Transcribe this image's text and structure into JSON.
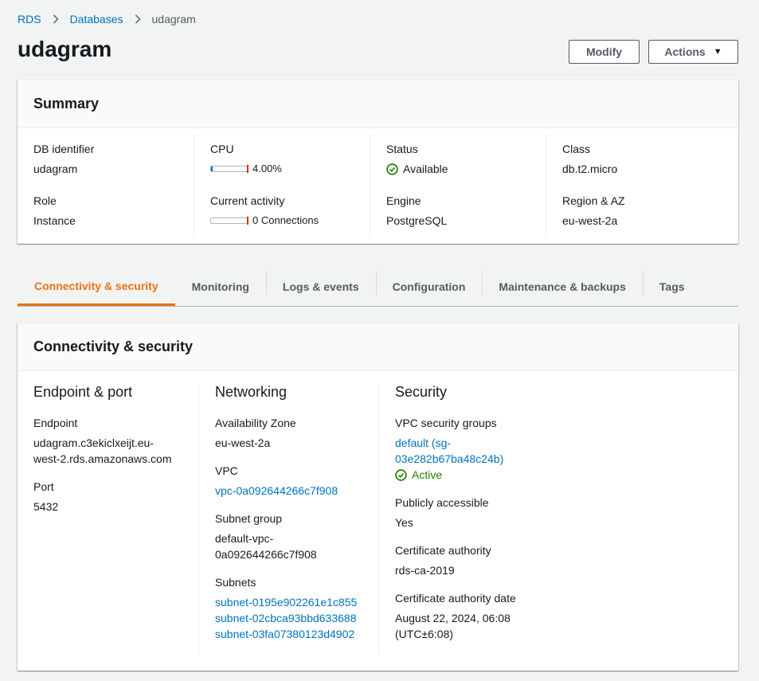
{
  "breadcrumb": {
    "items": [
      "RDS",
      "Databases"
    ],
    "current": "udagram"
  },
  "page": {
    "title": "udagram"
  },
  "buttons": {
    "modify": "Modify",
    "actions": "Actions"
  },
  "summary": {
    "title": "Summary",
    "db_identifier_label": "DB identifier",
    "db_identifier": "udagram",
    "role_label": "Role",
    "role": "Instance",
    "cpu_label": "CPU",
    "cpu_value": "4.00%",
    "cpu_fraction": 0.04,
    "activity_label": "Current activity",
    "activity_value": "0 Connections",
    "activity_fraction": 0,
    "status_label": "Status",
    "status": "Available",
    "engine_label": "Engine",
    "engine": "PostgreSQL",
    "class_label": "Class",
    "class": "db.t2.micro",
    "region_label": "Region & AZ",
    "region": "eu-west-2a"
  },
  "tabs": [
    {
      "label": "Connectivity & security",
      "active": true
    },
    {
      "label": "Monitoring",
      "active": false
    },
    {
      "label": "Logs & events",
      "active": false
    },
    {
      "label": "Configuration",
      "active": false
    },
    {
      "label": "Maintenance & backups",
      "active": false
    },
    {
      "label": "Tags",
      "active": false
    }
  ],
  "connectivity": {
    "title": "Connectivity & security",
    "endpoint_section": {
      "title": "Endpoint & port",
      "endpoint_label": "Endpoint",
      "endpoint_line1": "udagram.c3ekiclxeijt.eu-",
      "endpoint_line2": "west-2.rds.amazonaws.com",
      "port_label": "Port",
      "port": "5432"
    },
    "networking": {
      "title": "Networking",
      "az_label": "Availability Zone",
      "az": "eu-west-2a",
      "vpc_label": "VPC",
      "vpc": "vpc-0a092644266c7f908",
      "subnet_group_label": "Subnet group",
      "subnet_group_line1": "default-vpc-",
      "subnet_group_line2": "0a092644266c7f908",
      "subnets_label": "Subnets",
      "subnets": [
        "subnet-0195e902261e1c855",
        "subnet-02cbca93bbd633688",
        "subnet-03fa07380123d4902"
      ]
    },
    "security": {
      "title": "Security",
      "sg_label": "VPC security groups",
      "sg_line1": "default (sg-",
      "sg_line2": "03e282b67ba48c24b)",
      "sg_status": "Active",
      "public_label": "Publicly accessible",
      "public": "Yes",
      "ca_label": "Certificate authority",
      "ca": "rds-ca-2019",
      "ca_date_label": "Certificate authority date",
      "ca_date_line1": "August 22, 2024, 06:08",
      "ca_date_line2": "(UTC±6:08)"
    }
  },
  "colors": {
    "link": "#0073bb",
    "accent": "#ec7211",
    "success": "#1d8102",
    "meter_fill": "#0073bb",
    "meter_mark": "#d13212"
  }
}
